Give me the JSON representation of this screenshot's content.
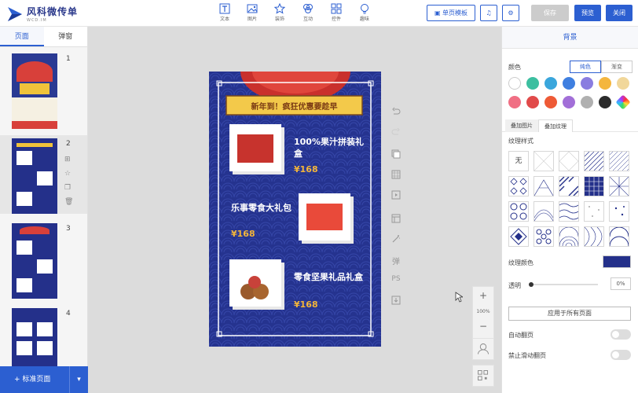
{
  "app": {
    "logo_name": "风科微传单",
    "logo_sub": "WCD.IM"
  },
  "toolbar": {
    "tools": [
      {
        "label": "文本",
        "icon": "text-icon"
      },
      {
        "label": "图片",
        "icon": "image-icon"
      },
      {
        "label": "装饰",
        "icon": "star-icon"
      },
      {
        "label": "互动",
        "icon": "interact-icon"
      },
      {
        "label": "控件",
        "icon": "widget-icon"
      },
      {
        "label": "趣味",
        "icon": "fun-icon"
      }
    ],
    "template_label": "单页模板",
    "save_label": "保存",
    "preview_label": "预览",
    "close_label": "关闭"
  },
  "left": {
    "tabs": [
      "页面",
      "弹窗"
    ],
    "active_tab": 0,
    "pages": [
      "1",
      "2",
      "3",
      "4"
    ],
    "selected_page": 1,
    "add_page_label": "标准页面"
  },
  "poster": {
    "title": "新年到！疯狂优惠要趁早",
    "items": [
      {
        "name": "100%果汁拼装礼盒",
        "price": "¥168"
      },
      {
        "name": "乐事零食大礼包",
        "price": "¥168"
      },
      {
        "name": "零食坚果礼品礼盒",
        "price": "¥168"
      }
    ]
  },
  "canvas": {
    "side_tools": [
      "undo-icon",
      "redo-icon",
      "layers-icon",
      "grid-icon",
      "play-icon",
      "layout-icon",
      "magic-icon",
      "弹",
      "PS",
      "export-icon"
    ],
    "zoom": "100%"
  },
  "right": {
    "header": "背景",
    "color_label": "颜色",
    "color_modes": [
      "纯色",
      "渐变"
    ],
    "colors": [
      "#ffffff",
      "#3cbfa0",
      "#3aa6dc",
      "#3f7fe0",
      "#8a7de0",
      "#f4b63e",
      "#f1d79a",
      "#f06f84",
      "#e14a4a",
      "#ee5a36",
      "#a26fd8",
      "#b0b0b0",
      "#2b2b2b",
      "rainbow"
    ],
    "sub_tabs": [
      "叠加图片",
      "叠加纹理"
    ],
    "active_sub_tab": 1,
    "texture_label": "纹理样式",
    "texture_none": "无",
    "texture_color_label": "纹理颜色",
    "texture_color": "#24308a",
    "opacity_label": "透明",
    "opacity_value": "0%",
    "apply_all_label": "应用于所有页面",
    "auto_flip_label": "自动翻页",
    "no_swipe_label": "禁止滑动翻页"
  }
}
